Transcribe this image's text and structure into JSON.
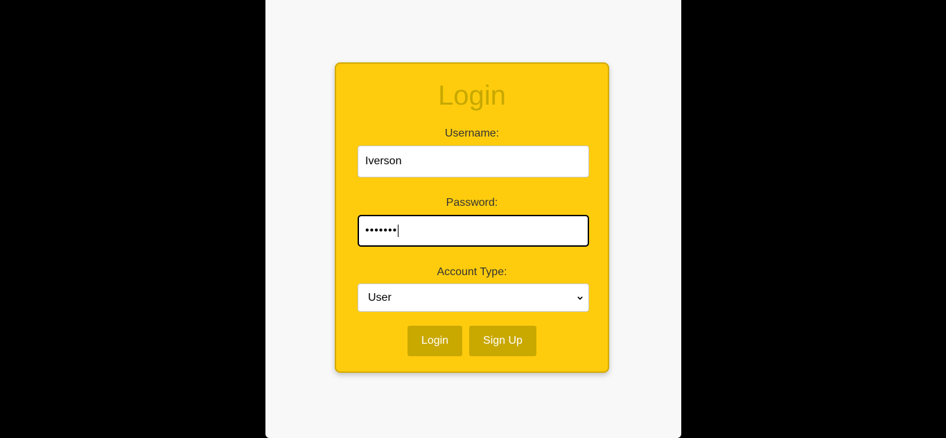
{
  "login_form": {
    "title": "Login",
    "username_label": "Username:",
    "username_value": "Iverson",
    "password_label": "Password:",
    "password_value": "•••••••",
    "account_type_label": "Account Type:",
    "account_type_selected": "User",
    "login_button": "Login",
    "signup_button": "Sign Up"
  },
  "colors": {
    "background": "#000000",
    "panel": "#f8f8f8",
    "card": "#ffcc0d",
    "card_border": "#d3aa00",
    "title": "#c7a800",
    "button": "#c9a800",
    "button_text": "#ffffff"
  },
  "icons": {
    "select_arrow": "chevron-down-icon"
  }
}
